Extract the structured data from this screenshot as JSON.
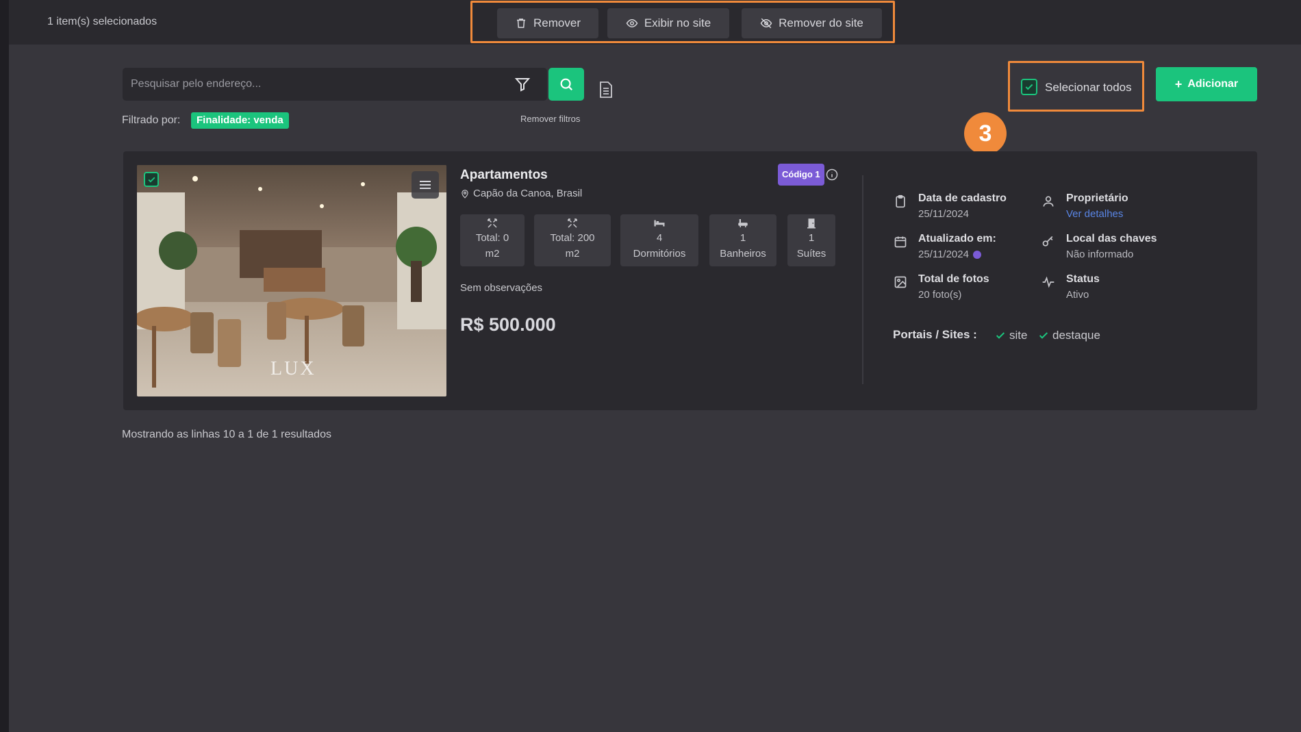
{
  "topbar": {
    "selected_count": "1 item(s) selecionados",
    "actions": {
      "remove": "Remover",
      "show_on_site": "Exibir no site",
      "remove_from_site": "Remover do site"
    }
  },
  "toolbar": {
    "search_placeholder": "Pesquisar pelo endereço...",
    "filtered_by_label": "Filtrado por:",
    "active_filter": "Finalidade: venda",
    "remove_filters": "Remover filtros",
    "select_all": "Selecionar todos",
    "select_all_checked": true,
    "add_button": "Adicionar"
  },
  "annotation": {
    "step_number": "3"
  },
  "listing": {
    "selected": true,
    "image_watermark": "LUX",
    "title": "Apartamentos",
    "location": "Capão da Canoa, Brasil",
    "code_badge": "Código 1",
    "features": [
      {
        "icon": "area-icon",
        "line1": "Total: 0",
        "line2": "m2"
      },
      {
        "icon": "area-icon",
        "line1": "Total: 200",
        "line2": "m2"
      },
      {
        "icon": "bed-icon",
        "line1": "4",
        "line2": "Dormitórios"
      },
      {
        "icon": "bath-icon",
        "line1": "1",
        "line2": "Banheiros"
      },
      {
        "icon": "door-icon",
        "line1": "1",
        "line2": "Suítes"
      }
    ],
    "observations": "Sem observações",
    "price": "R$ 500.000",
    "meta": {
      "created_label": "Data de cadastro",
      "created_value": "25/11/2024",
      "owner_label": "Proprietário",
      "owner_link": "Ver detalhes",
      "updated_label": "Atualizado em:",
      "updated_value": "25/11/2024",
      "keys_label": "Local das chaves",
      "keys_value": "Não informado",
      "photos_label": "Total de fotos",
      "photos_value": "20 foto(s)",
      "status_label": "Status",
      "status_value": "Ativo"
    },
    "portals_label": "Portais / Sites :",
    "portals": [
      "site",
      "destaque"
    ]
  },
  "footer": {
    "results_text": "Mostrando as linhas 10 a 1 de 1 resultados"
  },
  "colors": {
    "accent_green": "#1bc47d",
    "highlight_orange": "#f08a3b",
    "code_purple": "#7b5bd6",
    "link_blue": "#5a86e6"
  }
}
